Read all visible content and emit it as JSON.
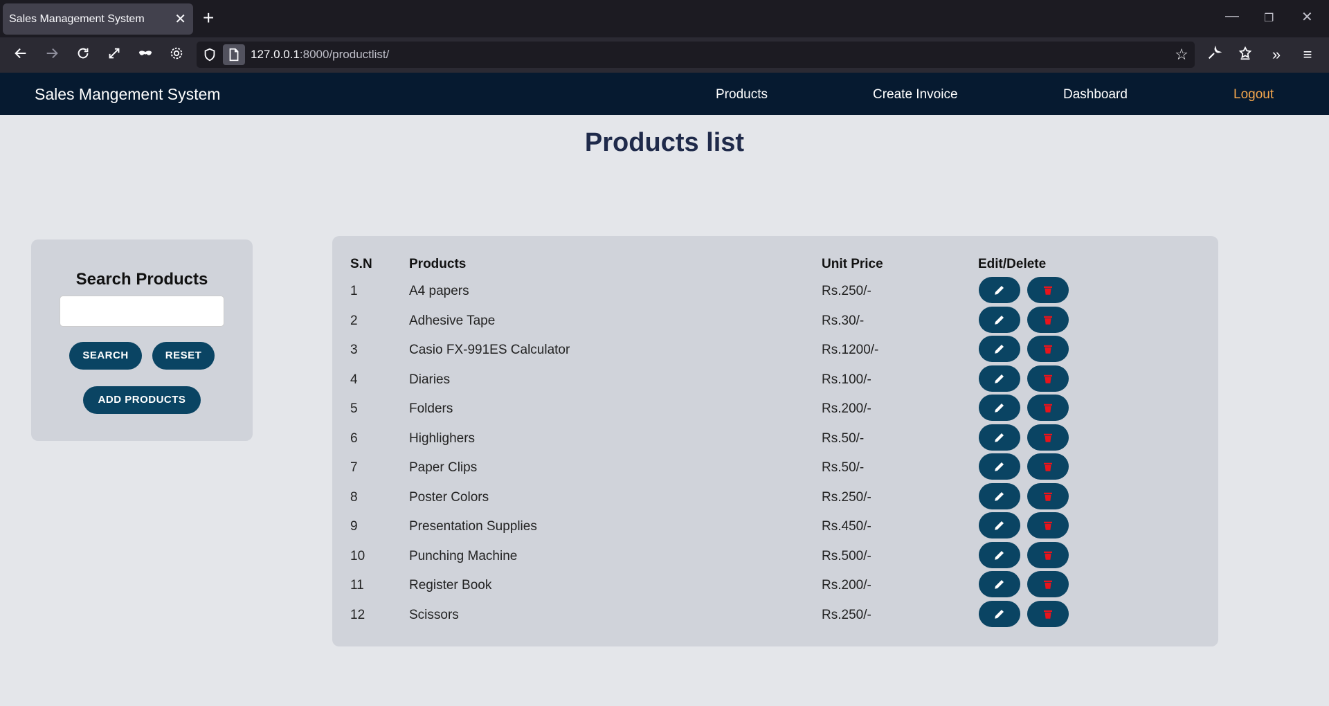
{
  "browser": {
    "tab_title": "Sales Management System",
    "url_host": "127.0.0.1",
    "url_path": ":8000/productlist/"
  },
  "app": {
    "brand": "Sales Mangement System",
    "nav": [
      "Products",
      "Create Invoice",
      "Dashboard",
      "Logout"
    ]
  },
  "page": {
    "title": "Products list"
  },
  "search": {
    "heading": "Search Products",
    "input_value": "",
    "search_label": "SEARCH",
    "reset_label": "RESET",
    "add_label": "ADD PRODUCTS"
  },
  "table": {
    "headers": [
      "S.N",
      "Products",
      "Unit Price",
      "Edit/Delete"
    ],
    "rows": [
      {
        "sn": "1",
        "product": "A4 papers",
        "price": "Rs.250/-"
      },
      {
        "sn": "2",
        "product": "Adhesive Tape",
        "price": "Rs.30/-"
      },
      {
        "sn": "3",
        "product": "Casio FX-991ES Calculator",
        "price": "Rs.1200/-"
      },
      {
        "sn": "4",
        "product": "Diaries",
        "price": "Rs.100/-"
      },
      {
        "sn": "5",
        "product": "Folders",
        "price": "Rs.200/-"
      },
      {
        "sn": "6",
        "product": "Highlighers",
        "price": "Rs.50/-"
      },
      {
        "sn": "7",
        "product": "Paper Clips",
        "price": "Rs.50/-"
      },
      {
        "sn": "8",
        "product": "Poster Colors",
        "price": "Rs.250/-"
      },
      {
        "sn": "9",
        "product": "Presentation Supplies",
        "price": "Rs.450/-"
      },
      {
        "sn": "10",
        "product": "Punching Machine",
        "price": "Rs.500/-"
      },
      {
        "sn": "11",
        "product": "Register Book",
        "price": "Rs.200/-"
      },
      {
        "sn": "12",
        "product": "Scissors",
        "price": "Rs.250/-"
      }
    ]
  },
  "colors": {
    "navbar": "#061a30",
    "accent_button": "#0a4463",
    "delete_icon": "#e8141c",
    "logout": "#f5a74d"
  },
  "icons": {
    "edit": "pencil-icon",
    "delete": "trash-icon"
  }
}
